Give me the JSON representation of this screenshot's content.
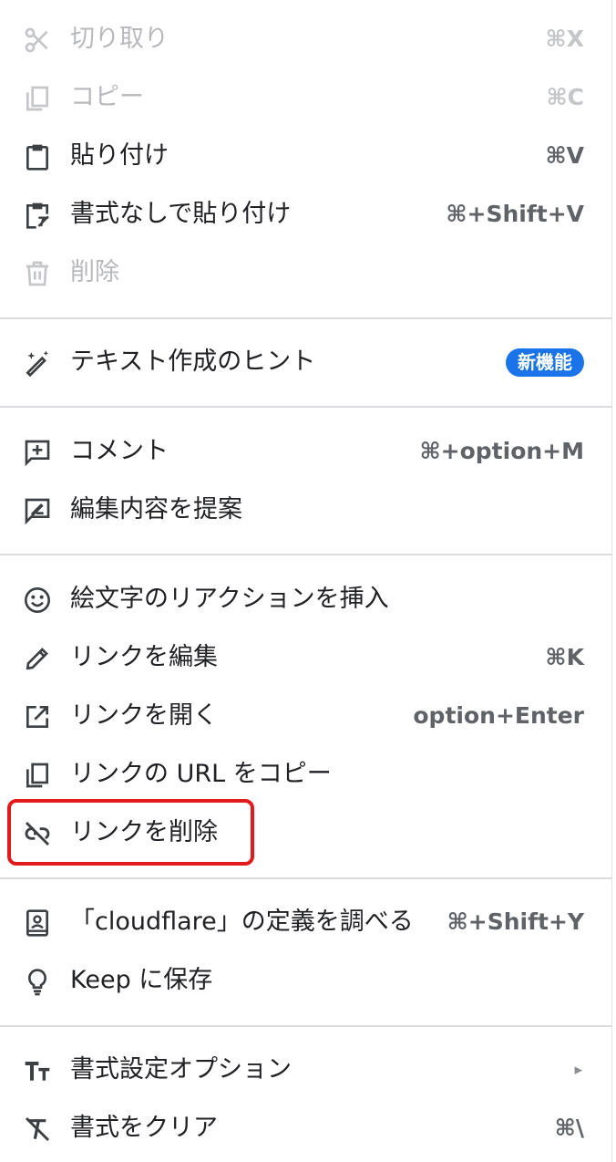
{
  "menu": {
    "items": {
      "cut": {
        "label": "切り取り",
        "shortcut": "⌘X",
        "icon": "scissors-icon",
        "disabled": true
      },
      "copy": {
        "label": "コピー",
        "shortcut": "⌘C",
        "icon": "copy-icon",
        "disabled": true
      },
      "paste": {
        "label": "貼り付け",
        "shortcut": "⌘V",
        "icon": "clipboard-icon"
      },
      "paste_plain": {
        "label": "書式なしで貼り付け",
        "shortcut": "⌘+Shift+V",
        "icon": "clipboard-clear-format-icon"
      },
      "delete": {
        "label": "削除",
        "icon": "trash-icon",
        "disabled": true
      },
      "writing_hint": {
        "label": "テキスト作成のヒント",
        "badge": "新機能",
        "icon": "magic-pen-icon"
      },
      "comment": {
        "label": "コメント",
        "shortcut": "⌘+option+M",
        "icon": "add-comment-icon"
      },
      "suggest_edits": {
        "label": "編集内容を提案",
        "icon": "suggest-edit-icon"
      },
      "emoji_reaction": {
        "label": "絵文字のリアクションを挿入",
        "icon": "smiley-icon"
      },
      "edit_link": {
        "label": "リンクを編集",
        "shortcut": "⌘K",
        "icon": "pencil-icon"
      },
      "open_link": {
        "label": "リンクを開く",
        "shortcut": "option+Enter",
        "icon": "open-external-icon"
      },
      "copy_link_url": {
        "label": "リンクの URL をコピー",
        "icon": "copy-icon"
      },
      "remove_link": {
        "label": "リンクを削除",
        "icon": "link-off-icon",
        "highlighted": true
      },
      "define": {
        "label": "「cloudflare」の定義を調べる",
        "shortcut": "⌘+Shift+Y",
        "icon": "dictionary-icon"
      },
      "keep": {
        "label": "Keep に保存",
        "icon": "lightbulb-icon"
      },
      "format_options": {
        "label": "書式設定オプション",
        "submenu_arrow": "▸",
        "icon": "text-format-icon"
      },
      "clear_format": {
        "label": "書式をクリア",
        "shortcut": "⌘\\",
        "icon": "clear-format-icon"
      }
    }
  },
  "colors": {
    "highlight_border": "#e11b1b",
    "badge_bg": "#1a73e8",
    "disabled_text": "#b7b9bc",
    "shortcut_text": "#5f6368"
  }
}
